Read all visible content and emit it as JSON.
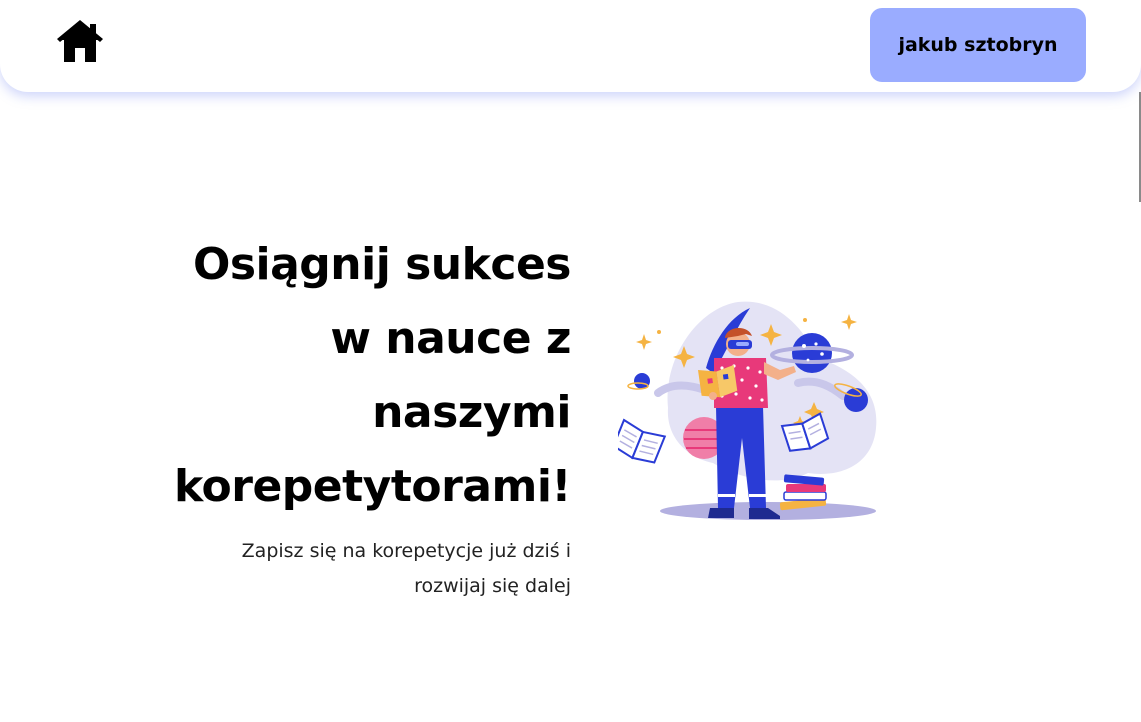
{
  "navbar": {
    "home_icon": "home-icon",
    "user_button_label": "jakub sztobryn"
  },
  "hero": {
    "title_lines": [
      "Osiągnij sukces",
      "w nauce z",
      "naszymi",
      "korepetytorami!"
    ],
    "subtitle_lines": [
      "Zapisz się na korepetycje już dziś i",
      "rozwijaj się dalej"
    ]
  },
  "illustration": {
    "icon": "student-studying-illustration"
  },
  "colors": {
    "accent": "#9aacff",
    "navbar_shadow": "#6e82f0",
    "illustration_blue": "#2a3cd6",
    "illustration_pink": "#e8397a",
    "illustration_star": "#f5b342"
  }
}
